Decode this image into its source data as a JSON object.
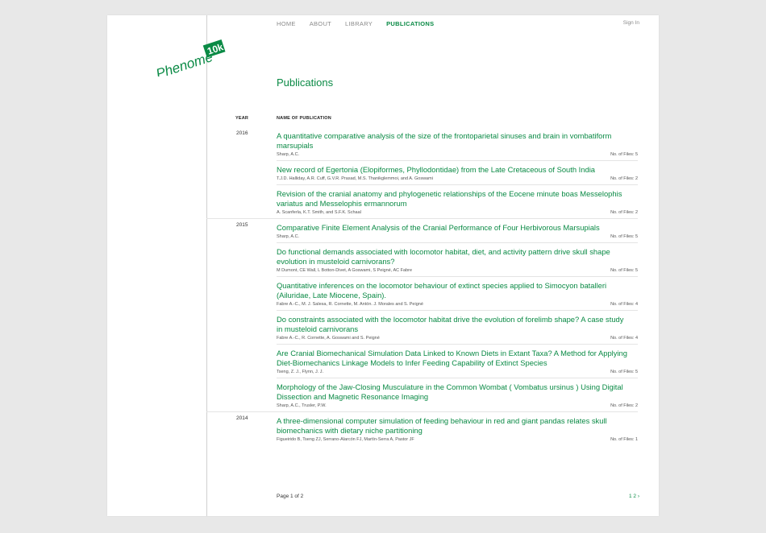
{
  "nav": {
    "items": [
      "HOME",
      "ABOUT",
      "LIBRARY",
      "PUBLICATIONS"
    ],
    "active": "PUBLICATIONS",
    "signin": "Sign In"
  },
  "logo": {
    "word": "Phenome",
    "badge": "10k"
  },
  "page_title": "Publications",
  "table": {
    "col_year": "YEAR",
    "col_name": "NAME OF PUBLICATION",
    "files_label": "No. of Files:",
    "rows": [
      {
        "year": "2016",
        "title": "A quantitative comparative analysis of the size of the frontoparietal sinuses and brain in vombatiform marsupials",
        "authors": "Sharp, A.C.",
        "files": "5"
      },
      {
        "year": "",
        "title": "New record of Egertonia (Elopiformes, Phyllodontidae) from the Late Cretaceous of South India",
        "authors": "T.J.D. Halliday, A.R. Cuff, G.V.R. Prasad, M.S. Thanikglemmoi, and A. Goswami",
        "files": "2"
      },
      {
        "year": "",
        "title": "Revision of the cranial anatomy and phylogenetic relationships of the Eocene minute boas Messelophis variatus and Messelophis ermannorum",
        "authors": "A. Scanferla, K.T. Smith, and S.F.K. Schaal",
        "files": "2"
      },
      {
        "year": "2015",
        "title": "Comparative Finite Element Analysis of the Cranial Performance of Four Herbivorous Marsupials",
        "authors": "Sharp, A.C.",
        "files": "5"
      },
      {
        "year": "",
        "title": "Do functional demands associated with locomotor habitat, diet, and activity pattern drive skull shape evolution in musteloid carnivorans?",
        "authors": "M Dumont, CE Wall, L Botton-Divet, A Goswami, S Peigné, AC Fabre",
        "files": "5"
      },
      {
        "year": "",
        "title": "Quantitative inferences on the locomotor behaviour of extinct species applied to Simocyon batalleri (Ailuridae, Late Miocene, Spain).",
        "authors": "Fabre A.-C., M. J. Salesa, R. Cornette, M. Antón. J. Morales and S. Peigné",
        "files": "4"
      },
      {
        "year": "",
        "title": "Do constraints associated with the locomotor habitat drive the evolution of forelimb shape? A case study in musteloid carnivorans",
        "authors": "Fabre A.-C., R. Cornette, A. Goswami and S. Peigné",
        "files": "4"
      },
      {
        "year": "",
        "title": "Are Cranial Biomechanical Simulation Data Linked to Known Diets in Extant Taxa? A Method for Applying Diet-Biomechanics Linkage Models to Infer Feeding Capability of Extinct Species",
        "authors": "Tseng, Z. J., Flynn, J. J.",
        "files": "5"
      },
      {
        "year": "",
        "title": "Morphology of the Jaw-Closing Musculature in the Common Wombat ( Vombatus ursinus ) Using Digital Dissection and Magnetic Resonance Imaging",
        "authors": "Sharp, A.C., Trusler, P.W.",
        "files": "2"
      },
      {
        "year": "2014",
        "title": "A three-dimensional computer simulation of feeding behaviour in red and giant pandas relates skull biomechanics with dietary niche partitioning",
        "authors": "Figueirido B, Tseng ZJ, Serrano-Alarcón FJ, Martín-Serra A, Pastor JF",
        "files": "1"
      }
    ]
  },
  "footer": {
    "page_info": "Page 1 of 2",
    "pager": "1 2 ›"
  },
  "colors": {
    "accent": "#0a8a45",
    "sidebar_line": "#cfcfcf",
    "background": "#e8e8e8"
  }
}
